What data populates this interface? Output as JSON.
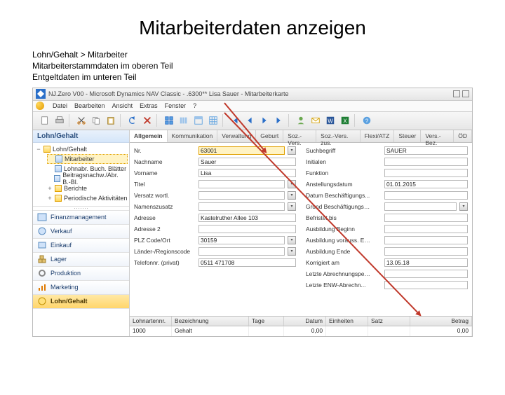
{
  "page_title": "Mitarbeiterdaten  anzeigen",
  "description": {
    "line1": "Lohn/Gehalt > Mitarbeiter",
    "line2": "Mitarbeiterstammdaten im oberen Teil",
    "line3": "Entgeltdaten im unteren Teil"
  },
  "window": {
    "title": "NJ.Zero V00 - Microsoft Dynamics NAV Classic - .6300** Lisa Sauer - Mitarbeiterkarte",
    "menu": [
      "Datei",
      "Bearbeiten",
      "Ansicht",
      "Extras",
      "Fenster",
      "?"
    ]
  },
  "sidebar": {
    "header": "Lohn/Gehalt",
    "tree": {
      "root": "Lohn/Gehalt",
      "items": [
        "Mitarbeiter",
        "Lohnabr. Buch. Blätter",
        "Beitragsnachw./Abr. B.-Bl.",
        "Berichte",
        "Periodische Aktivitäten"
      ]
    },
    "modules": [
      "Finanzmanagement",
      "Verkauf",
      "Einkauf",
      "Lager",
      "Produktion",
      "Marketing",
      "Lohn/Gehalt"
    ]
  },
  "tabs": [
    "Allgemein",
    "Kommunikation",
    "Verwaltung",
    "Geburt",
    "Soz.-Vers.",
    "Soz.-Vers. zus.",
    "Flexi/ATZ",
    "Steuer",
    "Vers.-Bez.",
    "ÖD"
  ],
  "form_left": [
    {
      "label": "Nr.",
      "value": "63001",
      "yellow": true,
      "dd": true
    },
    {
      "label": "Nachname",
      "value": "Sauer"
    },
    {
      "label": "Vorname",
      "value": "Lisa"
    },
    {
      "label": "Titel",
      "value": "",
      "dd": true
    },
    {
      "label": "Versatz wortl.",
      "value": "",
      "dd": true
    },
    {
      "label": "Namenszusatz",
      "value": "",
      "dd": true
    },
    {
      "label": "Adresse",
      "value": "Kastelruther Allee 103"
    },
    {
      "label": "Adresse 2",
      "value": ""
    },
    {
      "label": "PLZ Code/Ort",
      "value": "30159",
      "dd": true
    },
    {
      "label": "Länder-/Regionscode",
      "value": "",
      "dd": true
    },
    {
      "label": "Telefonnr. (privat)",
      "value": "0511 471708"
    }
  ],
  "form_right": [
    {
      "label": "Suchbegriff",
      "value": "SAUER"
    },
    {
      "label": "Initialen",
      "value": ""
    },
    {
      "label": "Funktion",
      "value": ""
    },
    {
      "label": "Anstellungsdatum",
      "value": "01.01.2015"
    },
    {
      "label": "Datum Beschäftigungs...",
      "value": ""
    },
    {
      "label": "Grund Beschäftigungs…",
      "value": "",
      "dd": true
    },
    {
      "label": "Befristet bis",
      "value": ""
    },
    {
      "label": "Ausbildung Beginn",
      "value": ""
    },
    {
      "label": "Ausbildung vorauss. E…",
      "value": ""
    },
    {
      "label": "Ausbildung Ende",
      "value": ""
    },
    {
      "label": "Korrigiert am",
      "value": "13.05.18"
    },
    {
      "label": "Letzte Abrechnungspe…",
      "value": ""
    },
    {
      "label": "Letzte ENW-Abrechn...",
      "value": ""
    }
  ],
  "grid": {
    "headers": [
      "Lohnartennr.",
      "Bezeichnung",
      "Tage",
      "Datum",
      "Einheiten",
      "Satz",
      "Betrag"
    ],
    "row": [
      "1000",
      "Gehalt",
      "",
      "0,00",
      "",
      "",
      "0,00"
    ]
  },
  "colors": {
    "accent": "#2a4e7d",
    "highlight": "#fff3c4",
    "arrow": "#c0392b"
  }
}
